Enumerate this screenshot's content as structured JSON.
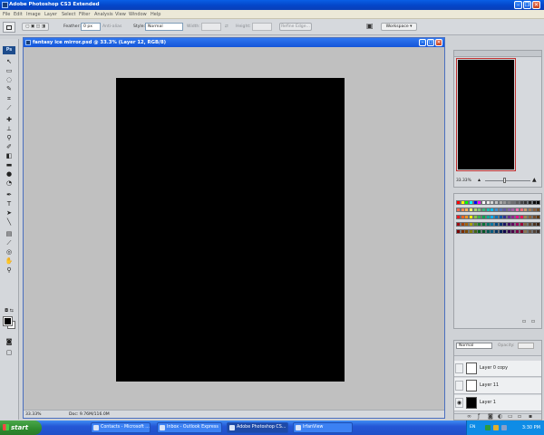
{
  "app": {
    "title": "Adobe Photoshop CS3 Extended"
  },
  "menu": [
    "File",
    "Edit",
    "Image",
    "Layer",
    "Select",
    "Filter",
    "Analysis",
    "View",
    "Window",
    "Help"
  ],
  "options": {
    "feather_label": "Feather:",
    "feather_value": "0 px",
    "antialias_label": "Anti-alias",
    "style_label": "Style:",
    "style_value": "Normal",
    "width_label": "Width:",
    "height_label": "Height:",
    "refine_edge": "Refine Edge...",
    "workspace": "Workspace ▾"
  },
  "document": {
    "title": "fantasy ice mirror.psd @ 33.3% (Layer 12, RGB/8)",
    "zoom": "33.33%",
    "doc_size": "Doc: 9.76M/116.0M"
  },
  "navigator": {
    "zoom": "33.33%"
  },
  "swatches": {
    "colors": [
      "#ff0000",
      "#ffff00",
      "#00ff00",
      "#00ffff",
      "#0000ff",
      "#ff00ff",
      "#ffffff",
      "#ebebeb",
      "#d6d6d6",
      "#c2c2c2",
      "#adadad",
      "#999999",
      "#858585",
      "#707070",
      "#5c5c5c",
      "#474747",
      "#333333",
      "#1f1f1f",
      "#0a0a0a",
      "#000000",
      "#f26c4f",
      "#f68e56",
      "#fbaf5d",
      "#fff568",
      "#acd372",
      "#7cc576",
      "#3bb878",
      "#1abbb4",
      "#00bff3",
      "#438ccb",
      "#5574b9",
      "#605ca8",
      "#855fa8",
      "#a763a8",
      "#f06ea9",
      "#f26d7d",
      "#c69c6d",
      "#a67c52",
      "#8b5e3c",
      "#754c24",
      "#ed1c24",
      "#f26522",
      "#f7941d",
      "#fff200",
      "#8dc63f",
      "#39b54a",
      "#00a651",
      "#00a99d",
      "#00aeef",
      "#0072bc",
      "#0054a6",
      "#2e3192",
      "#662d91",
      "#92278f",
      "#ec008c",
      "#ed145b",
      "#a2844a",
      "#8c6239",
      "#744b28",
      "#603913",
      "#9e0b0f",
      "#a0410d",
      "#a36209",
      "#aba000",
      "#598527",
      "#197b30",
      "#007236",
      "#00746b",
      "#0076a3",
      "#004a80",
      "#003471",
      "#1b1464",
      "#440e62",
      "#630460",
      "#9e005d",
      "#9e0039",
      "#7a6644",
      "#614730",
      "#4d331f",
      "#3b2314",
      "#790000",
      "#7b2e00",
      "#7d4900",
      "#827b00",
      "#406618",
      "#005e20",
      "#005826",
      "#005952",
      "#005b7f",
      "#003663",
      "#002157",
      "#0d004c",
      "#32004b",
      "#4b0049",
      "#7b0046",
      "#7a0026",
      "#8c7853",
      "#6b5540",
      "#544235",
      "#3d2f27"
    ]
  },
  "layers": {
    "blend_mode": "Normal",
    "opacity_label": "Opacity:",
    "items": [
      {
        "name": "Layer 0 copy",
        "visible": false,
        "thumb": "#ffffff"
      },
      {
        "name": "Layer 11",
        "visible": false,
        "thumb": "#ffffff"
      },
      {
        "name": "Layer 1",
        "visible": true,
        "thumb": "#000000"
      }
    ]
  },
  "taskbar": {
    "start": "start",
    "items": [
      {
        "label": "Contacts - Microsoft ..."
      },
      {
        "label": "Inbox - Outlook Express"
      },
      {
        "label": "Adobe Photoshop CS..."
      },
      {
        "label": "IrfanView"
      }
    ],
    "lang": "EN",
    "time": "3:30 PM"
  }
}
